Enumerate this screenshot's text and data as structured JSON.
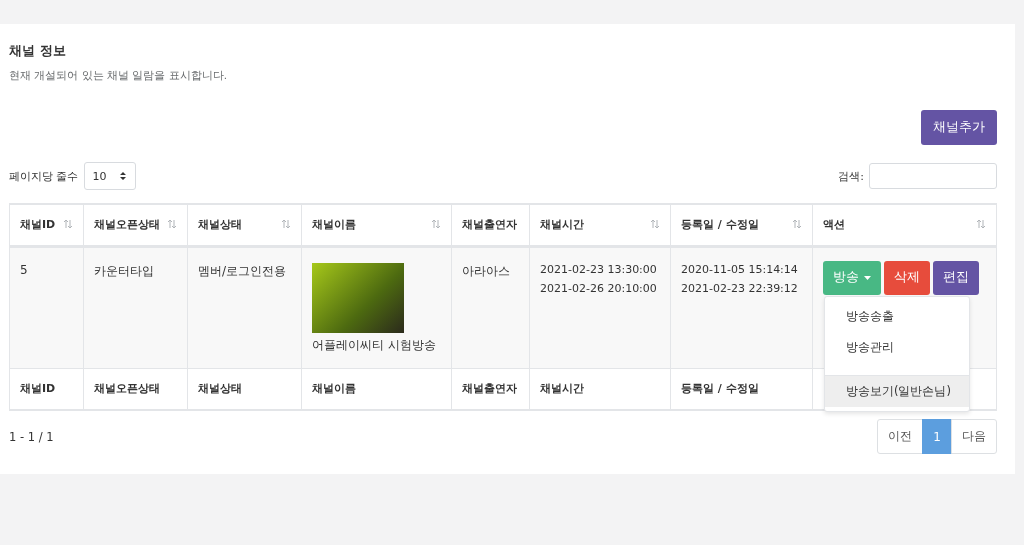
{
  "card": {
    "title": "채널 정보",
    "subtitle": "현재 개설되어 있는 채널 일람을 표시합니다."
  },
  "add_button": "채널추가",
  "page_length": {
    "label": "페이지당 줄수",
    "value": "10"
  },
  "search": {
    "label": "검색:"
  },
  "table": {
    "columns": [
      {
        "label": "채널ID",
        "sortable": true
      },
      {
        "label": "채널오픈상태",
        "sortable": true
      },
      {
        "label": "채널상태",
        "sortable": true
      },
      {
        "label": "채널이름",
        "sortable": true
      },
      {
        "label": "채널출연자",
        "sortable": false
      },
      {
        "label": "채널시간",
        "sortable": true
      },
      {
        "label": "등록일 / 수정일",
        "sortable": true
      },
      {
        "label": "액션",
        "sortable": true
      }
    ],
    "rows": [
      {
        "id": "5",
        "open_state": "카운터타입",
        "state": "멤버/로그인전용",
        "name": "어플레이씨티 시험방송",
        "performer": "아라아스",
        "times": [
          "2021-02-23 13:30:00",
          "2021-02-26 20:10:00"
        ],
        "dates": [
          "2020-11-05 15:14:14",
          "2021-02-23 22:39:12"
        ],
        "actions": [
          {
            "label": "방송",
            "kind": "dropdown",
            "color": "#48b884"
          },
          {
            "label": "삭제",
            "kind": "plain",
            "color": "#e74c3c"
          },
          {
            "label": "편집",
            "kind": "plain",
            "color": "#6454a4"
          }
        ],
        "menu": [
          {
            "label": "방송송출",
            "highlighted": false,
            "divider_before": false
          },
          {
            "label": "방송관리",
            "highlighted": false,
            "divider_before": false
          },
          {
            "label": "방송보기(일반손님)",
            "highlighted": true,
            "divider_before": true
          }
        ]
      }
    ],
    "footer": [
      "채널ID",
      "채널오픈상태",
      "채널상태",
      "채널이름",
      "채널출연자",
      "채널시간",
      "등록일 / 수정일"
    ]
  },
  "info": "1 - 1 / 1",
  "pagination": [
    {
      "label": "이전",
      "selected": false
    },
    {
      "label": "1",
      "selected": true
    },
    {
      "label": "다음",
      "selected": false
    }
  ]
}
